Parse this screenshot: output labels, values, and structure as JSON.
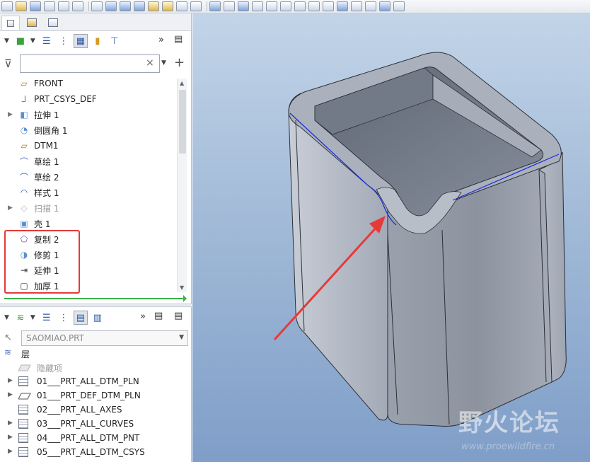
{
  "toolbar": {
    "icons": [
      "new-icon",
      "open-icon",
      "save-icon",
      "regenerate-icon",
      "window-icon",
      "undo-icon",
      "redo-icon",
      "sketch-icon",
      "extrude-icon",
      "revolve-icon",
      "datum-plane-icon",
      "axis-icon",
      "point-icon",
      "csys-icon",
      "view-icon",
      "appearance-icon",
      "sweep-icon",
      "blend-icon",
      "shell-icon",
      "rib-icon",
      "measure-icon",
      "copy-icon",
      "paste-icon"
    ]
  },
  "model_tree": {
    "search_placeholder": "",
    "items": [
      {
        "label": "FRONT",
        "icon": "datum-plane-icon",
        "expandable": false,
        "disabled": false
      },
      {
        "label": "PRT_CSYS_DEF",
        "icon": "csys-icon",
        "expandable": false,
        "disabled": false
      },
      {
        "label": "拉伸 1",
        "icon": "extrude-icon",
        "expandable": true,
        "disabled": false
      },
      {
        "label": "倒圆角 1",
        "icon": "round-icon",
        "expandable": false,
        "disabled": false
      },
      {
        "label": "DTM1",
        "icon": "datum-plane-icon",
        "expandable": false,
        "disabled": false
      },
      {
        "label": "草绘 1",
        "icon": "sketch-icon",
        "expandable": false,
        "disabled": false
      },
      {
        "label": "草绘 2",
        "icon": "sketch-icon",
        "expandable": false,
        "disabled": false
      },
      {
        "label": "样式 1",
        "icon": "style-icon",
        "expandable": false,
        "disabled": false
      },
      {
        "label": "扫描 1",
        "icon": "sweep-icon",
        "expandable": true,
        "disabled": true
      },
      {
        "label": "壳 1",
        "icon": "shell-icon",
        "expandable": false,
        "disabled": false
      },
      {
        "label": "复制 2",
        "icon": "copy-surface-icon",
        "expandable": false,
        "disabled": false
      },
      {
        "label": "修剪 1",
        "icon": "trim-icon",
        "expandable": false,
        "disabled": false
      },
      {
        "label": "延伸 1",
        "icon": "extend-icon",
        "expandable": false,
        "disabled": false
      },
      {
        "label": "加厚 1",
        "icon": "thicken-icon",
        "expandable": false,
        "disabled": false
      }
    ]
  },
  "layer_tree": {
    "model_name": "SAOMIAO.PRT",
    "root_label": "层",
    "hidden_label": "隐藏项",
    "items": [
      {
        "label": "01___PRT_ALL_DTM_PLN",
        "expandable": true
      },
      {
        "label": "01___PRT_DEF_DTM_PLN",
        "expandable": true
      },
      {
        "label": "02___PRT_ALL_AXES",
        "expandable": false
      },
      {
        "label": "03___PRT_ALL_CURVES",
        "expandable": true
      },
      {
        "label": "04___PRT_ALL_DTM_PNT",
        "expandable": true
      },
      {
        "label": "05___PRT_ALL_DTM_CSYS",
        "expandable": true
      }
    ]
  },
  "watermark": {
    "text_a": "野",
    "text_b": "火",
    "text_c": "论坛",
    "url": "www.proewildfire.cn"
  },
  "colors": {
    "highlight": "#e53a3a",
    "insert_line": "#3bb34a",
    "model_edge": "#2c2f36",
    "selected_edge": "#1a2ad8",
    "viewport_top": "#c2d4e8",
    "viewport_bottom": "#7f9ec8"
  }
}
